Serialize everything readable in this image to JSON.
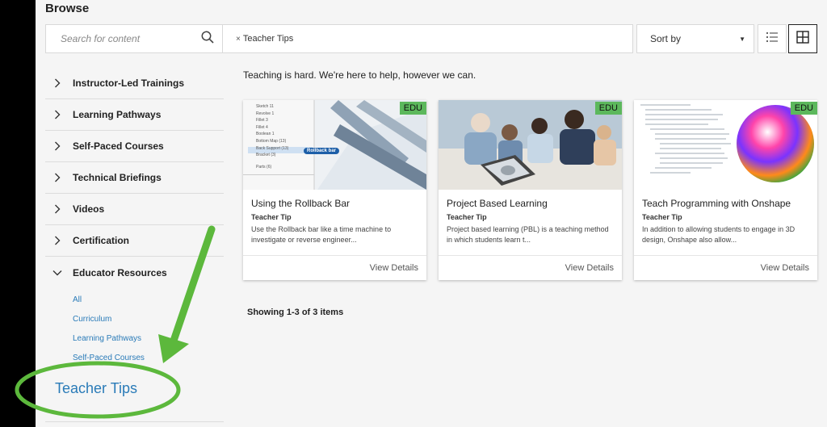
{
  "header": {
    "title": "Browse"
  },
  "search": {
    "placeholder": "Search for content"
  },
  "filters": {
    "active_chip": "Teacher Tips",
    "remove_glyph": "×"
  },
  "sort": {
    "label": "Sort by"
  },
  "sidebar": {
    "categories": [
      {
        "label": "Instructor-Led Trainings",
        "expanded": false
      },
      {
        "label": "Learning Pathways",
        "expanded": false
      },
      {
        "label": "Self-Paced Courses",
        "expanded": false
      },
      {
        "label": "Technical Briefings",
        "expanded": false
      },
      {
        "label": "Videos",
        "expanded": false
      },
      {
        "label": "Certification",
        "expanded": false
      },
      {
        "label": "Educator Resources",
        "expanded": true
      }
    ],
    "subitems": [
      "All",
      "Curriculum",
      "Learning Pathways",
      "Self-Paced Courses",
      "Teacher Tips"
    ]
  },
  "main": {
    "intro": "Teaching is hard.  We're here to help, however we can.",
    "badge": "EDU",
    "cards": [
      {
        "title": "Using the Rollback Bar",
        "type": "Teacher Tip",
        "description": "Use the Rollback bar like a time machine to investigate or reverse engineer...",
        "link": "View Details",
        "thumb_labels": [
          "Sketch 11",
          "Revolve 1",
          "Fillet 3",
          "Fillet 4",
          "Boolean 1",
          "Bottom Map (13)",
          "Back Support (13)",
          "Bracket (3)",
          "Parts (6)"
        ],
        "callout": "Rollback bar"
      },
      {
        "title": "Project Based Learning",
        "type": "Teacher Tip",
        "description": "Project based learning (PBL) is a teaching method in which students learn t...",
        "link": "View Details"
      },
      {
        "title": "Teach Programming with Onshape",
        "type": "Teacher Tip",
        "description": "In addition to allowing students to engage in 3D design, Onshape also allow...",
        "link": "View Details"
      }
    ],
    "status": "Showing 1-3 of 3 items"
  },
  "colors": {
    "accent_link": "#2a7bb8",
    "badge_green": "#5cb85c",
    "annotation_green": "#5cb83c"
  },
  "icons": [
    "search-icon",
    "close-icon",
    "caret-down-icon",
    "list-view-icon",
    "grid-view-icon",
    "chevron-right-icon",
    "chevron-down-icon"
  ]
}
